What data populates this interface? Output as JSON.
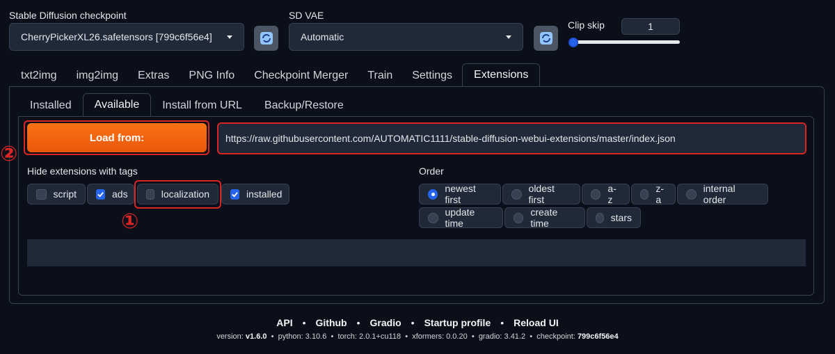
{
  "header": {
    "checkpoint_label": "Stable Diffusion checkpoint",
    "checkpoint_value": "CherryPickerXL26.safetensors [799c6f56e4]",
    "vae_label": "SD VAE",
    "vae_value": "Automatic",
    "clip_label": "Clip skip",
    "clip_value": "1"
  },
  "tabs": [
    "txt2img",
    "img2img",
    "Extras",
    "PNG Info",
    "Checkpoint Merger",
    "Train",
    "Settings",
    "Extensions"
  ],
  "subtabs": [
    "Installed",
    "Available",
    "Install from URL",
    "Backup/Restore"
  ],
  "load_button": "Load from:",
  "url_value": "https://raw.githubusercontent.com/AUTOMATIC1111/stable-diffusion-webui-extensions/master/index.json",
  "hide_label": "Hide extensions with tags",
  "tags": [
    {
      "label": "script",
      "checked": false
    },
    {
      "label": "ads",
      "checked": true
    },
    {
      "label": "localization",
      "checked": false
    },
    {
      "label": "installed",
      "checked": true
    }
  ],
  "order_label": "Order",
  "order_options": [
    "newest first",
    "oldest first",
    "a-z",
    "z-a",
    "internal order",
    "update time",
    "create time",
    "stars"
  ],
  "annotations": {
    "one": "①",
    "two": "②"
  },
  "footer": {
    "links": [
      "API",
      "Github",
      "Gradio",
      "Startup profile",
      "Reload UI"
    ],
    "sep": "•",
    "version_label": "version:",
    "version": "v1.6.0",
    "python_label": "python:",
    "python": "3.10.6",
    "torch_label": "torch:",
    "torch": "2.0.1+cu118",
    "xformers_label": "xformers:",
    "xformers": "0.0.20",
    "gradio_label": "gradio:",
    "gradio": "3.41.2",
    "checkpoint_label": "checkpoint:",
    "checkpoint": "799c6f56e4"
  },
  "colors": {
    "accent": "#2563eb",
    "orange": "#f97316",
    "annotation": "#dc2626"
  }
}
